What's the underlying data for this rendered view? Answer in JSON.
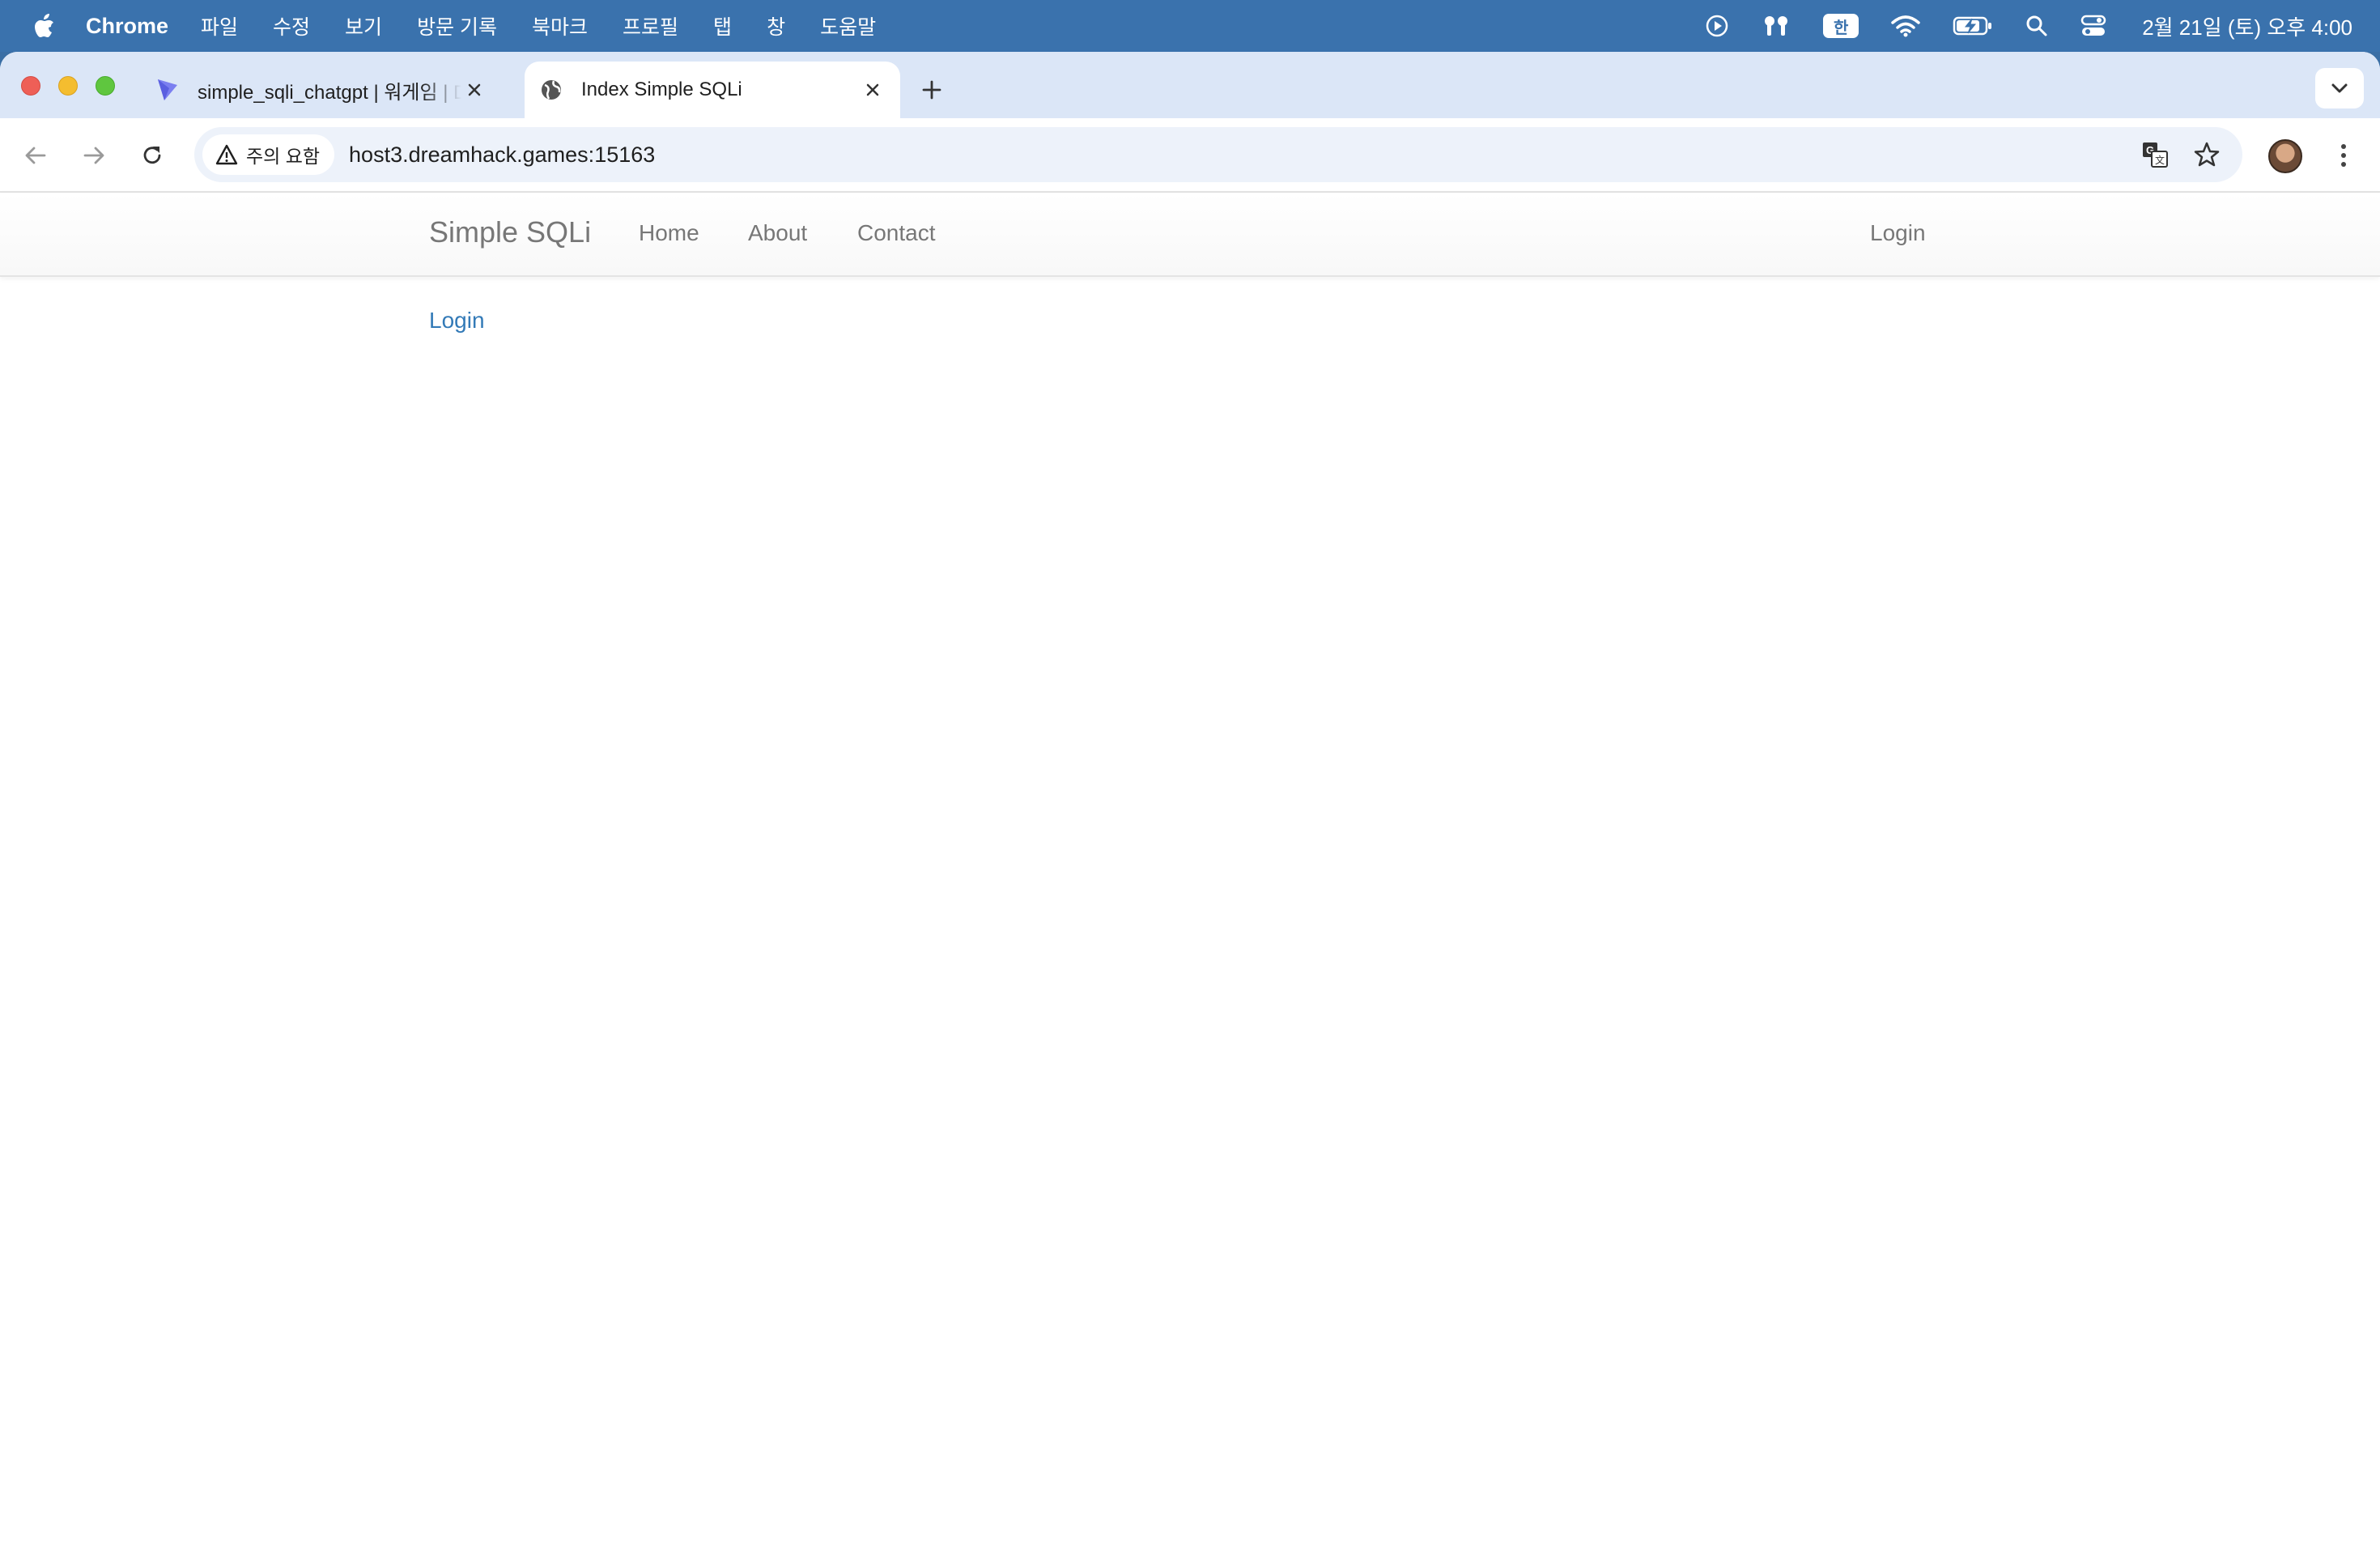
{
  "menubar": {
    "app_name": "Chrome",
    "items": [
      "파일",
      "수정",
      "보기",
      "방문 기록",
      "북마크",
      "프로필",
      "탭",
      "창",
      "도움말"
    ],
    "ime": "한",
    "clock": "2월 21일 (토) 오후 4:00"
  },
  "tabs": [
    {
      "title": "simple_sqli_chatgpt | 워게임 | Dreamhack",
      "active": false
    },
    {
      "title": "Index Simple SQLi",
      "active": true
    }
  ],
  "omnibox": {
    "security_label": "주의 요함",
    "url": "host3.dreamhack.games:15163"
  },
  "site": {
    "brand": "Simple SQLi",
    "nav": {
      "home": "Home",
      "about": "About",
      "contact": "Contact",
      "login": "Login"
    },
    "content_link": "Login"
  },
  "colors": {
    "menubar": "#3a72ad",
    "tabstrip": "#dbe6f7",
    "link": "#337ab7",
    "nav_text": "#777777"
  }
}
